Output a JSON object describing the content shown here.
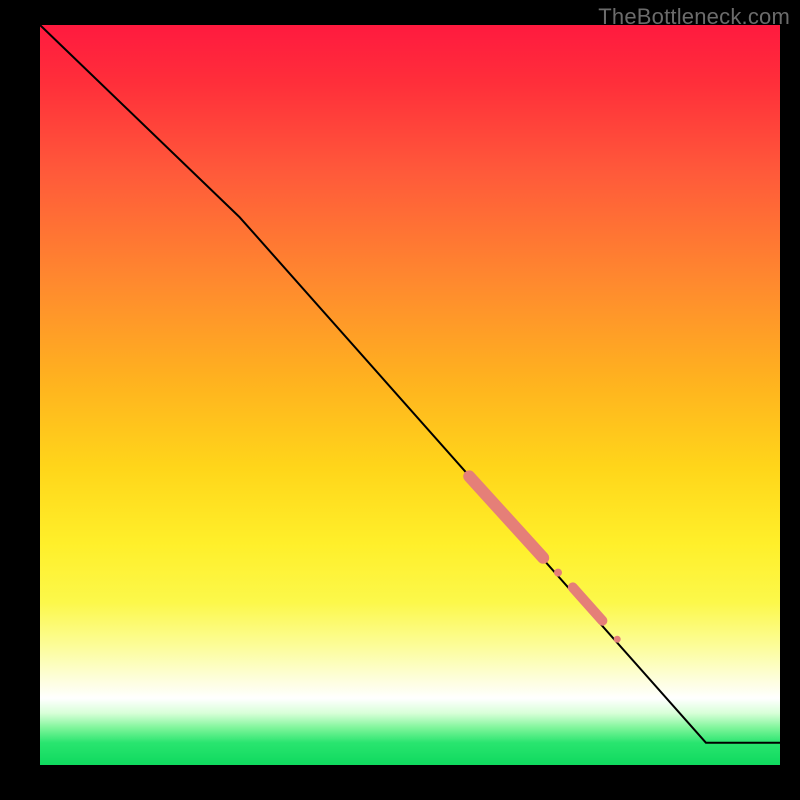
{
  "watermark": "TheBottleneck.com",
  "chart_data": {
    "type": "line",
    "title": "",
    "xlabel": "",
    "ylabel": "",
    "xlim": [
      0,
      100
    ],
    "ylim": [
      0,
      100
    ],
    "grid": false,
    "series": [
      {
        "name": "curve",
        "x": [
          0,
          27,
          90,
          100
        ],
        "y": [
          100,
          74,
          3,
          3
        ],
        "color": "#000000",
        "width": 2
      }
    ],
    "highlights": [
      {
        "shape": "segment",
        "x0": 58,
        "y0": 39,
        "x1": 68,
        "y1": 28,
        "width": 12,
        "color": "#e57f78"
      },
      {
        "shape": "dot",
        "x": 70,
        "y": 26,
        "r": 4,
        "color": "#e57f78"
      },
      {
        "shape": "segment",
        "x0": 72,
        "y0": 24,
        "x1": 76,
        "y1": 19.5,
        "width": 10,
        "color": "#e57f78"
      },
      {
        "shape": "dot",
        "x": 78,
        "y": 17,
        "r": 3.5,
        "color": "#e57f78"
      }
    ]
  }
}
